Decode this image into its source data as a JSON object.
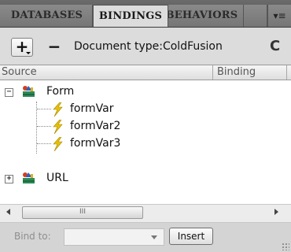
{
  "tabs": [
    {
      "label": "DATABASES",
      "state": "inactive"
    },
    {
      "label": "BINDINGS",
      "state": "active"
    },
    {
      "label": "BEHAVIORS",
      "state": "inactive"
    }
  ],
  "tab_menu_icon": "panel-menu-icon",
  "toolbar": {
    "add_icon": "+",
    "remove_icon": "−",
    "document_type_label": "Document type:ColdFusion",
    "refresh_icon": "refresh-icon"
  },
  "columns": {
    "source": "Source",
    "binding": "Binding"
  },
  "tree": [
    {
      "label": "Form",
      "expanded": true,
      "icon": "form-icon",
      "children": [
        {
          "label": "formVar",
          "icon": "lightning-icon"
        },
        {
          "label": "formVar2",
          "icon": "lightning-icon"
        },
        {
          "label": "formVar3",
          "icon": "lightning-icon"
        }
      ]
    },
    {
      "label": "URL",
      "expanded": false,
      "icon": "url-icon",
      "children": []
    }
  ],
  "expand_symbols": {
    "expanded": "−",
    "collapsed": "+"
  },
  "scrollbar": {
    "thumb_grip": "III"
  },
  "bottom": {
    "bind_to_label": "Bind to:",
    "bind_to_value": "",
    "insert_label": "Insert"
  },
  "colors": {
    "tab_bar": "#5d5d5d",
    "panel_bg": "#dcdcdc",
    "tree_bg": "#ffffff",
    "lightning": "#e8c200"
  }
}
